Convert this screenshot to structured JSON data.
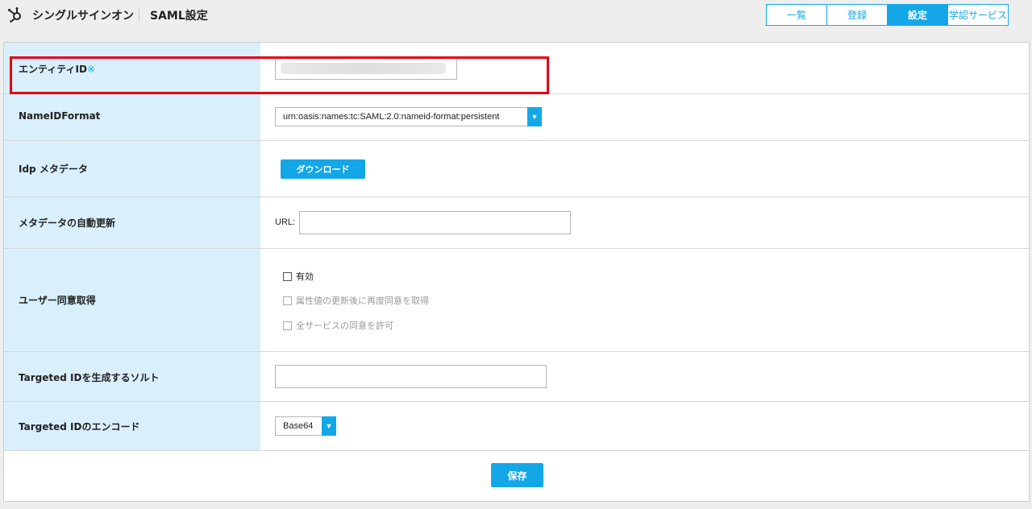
{
  "header": {
    "title": "シングルサインオン",
    "subtitle": "SAML設定",
    "logo_icon": "hubspot-sprocket-icon",
    "tabs": [
      {
        "label": "一覧",
        "active": false
      },
      {
        "label": "登録",
        "active": false
      },
      {
        "label": "設定",
        "active": true
      },
      {
        "label": "学認サービス",
        "active": false
      }
    ]
  },
  "form": {
    "entity_id": {
      "label": "エンティティID",
      "required_mark": "※",
      "value": ""
    },
    "name_id_format": {
      "label": "NameIDFormat",
      "selected": "urn:oasis:names:tc:SAML:2.0:nameid-format:persistent"
    },
    "idp_metadata": {
      "label": "Idp メタデータ",
      "button": "ダウンロード"
    },
    "metadata_auto_update": {
      "label": "メタデータの自動更新",
      "url_label": "URL:",
      "url_value": ""
    },
    "user_consent": {
      "label": "ユーザー同意取得",
      "options": [
        {
          "label": "有効",
          "checked": false,
          "disabled": false
        },
        {
          "label": "属性値の更新後に再度同意を取得",
          "checked": false,
          "disabled": true
        },
        {
          "label": "全サービスの同意を許可",
          "checked": false,
          "disabled": true
        }
      ]
    },
    "targeted_id_salt": {
      "label": "Targeted IDを生成するソルト",
      "value": ""
    },
    "targeted_id_encode": {
      "label": "Targeted IDのエンコード",
      "selected": "Base64"
    },
    "save_button": "保存"
  },
  "colors": {
    "accent": "#14a7e8",
    "label_bg": "#d9f0fc",
    "highlight": "#e60012"
  }
}
